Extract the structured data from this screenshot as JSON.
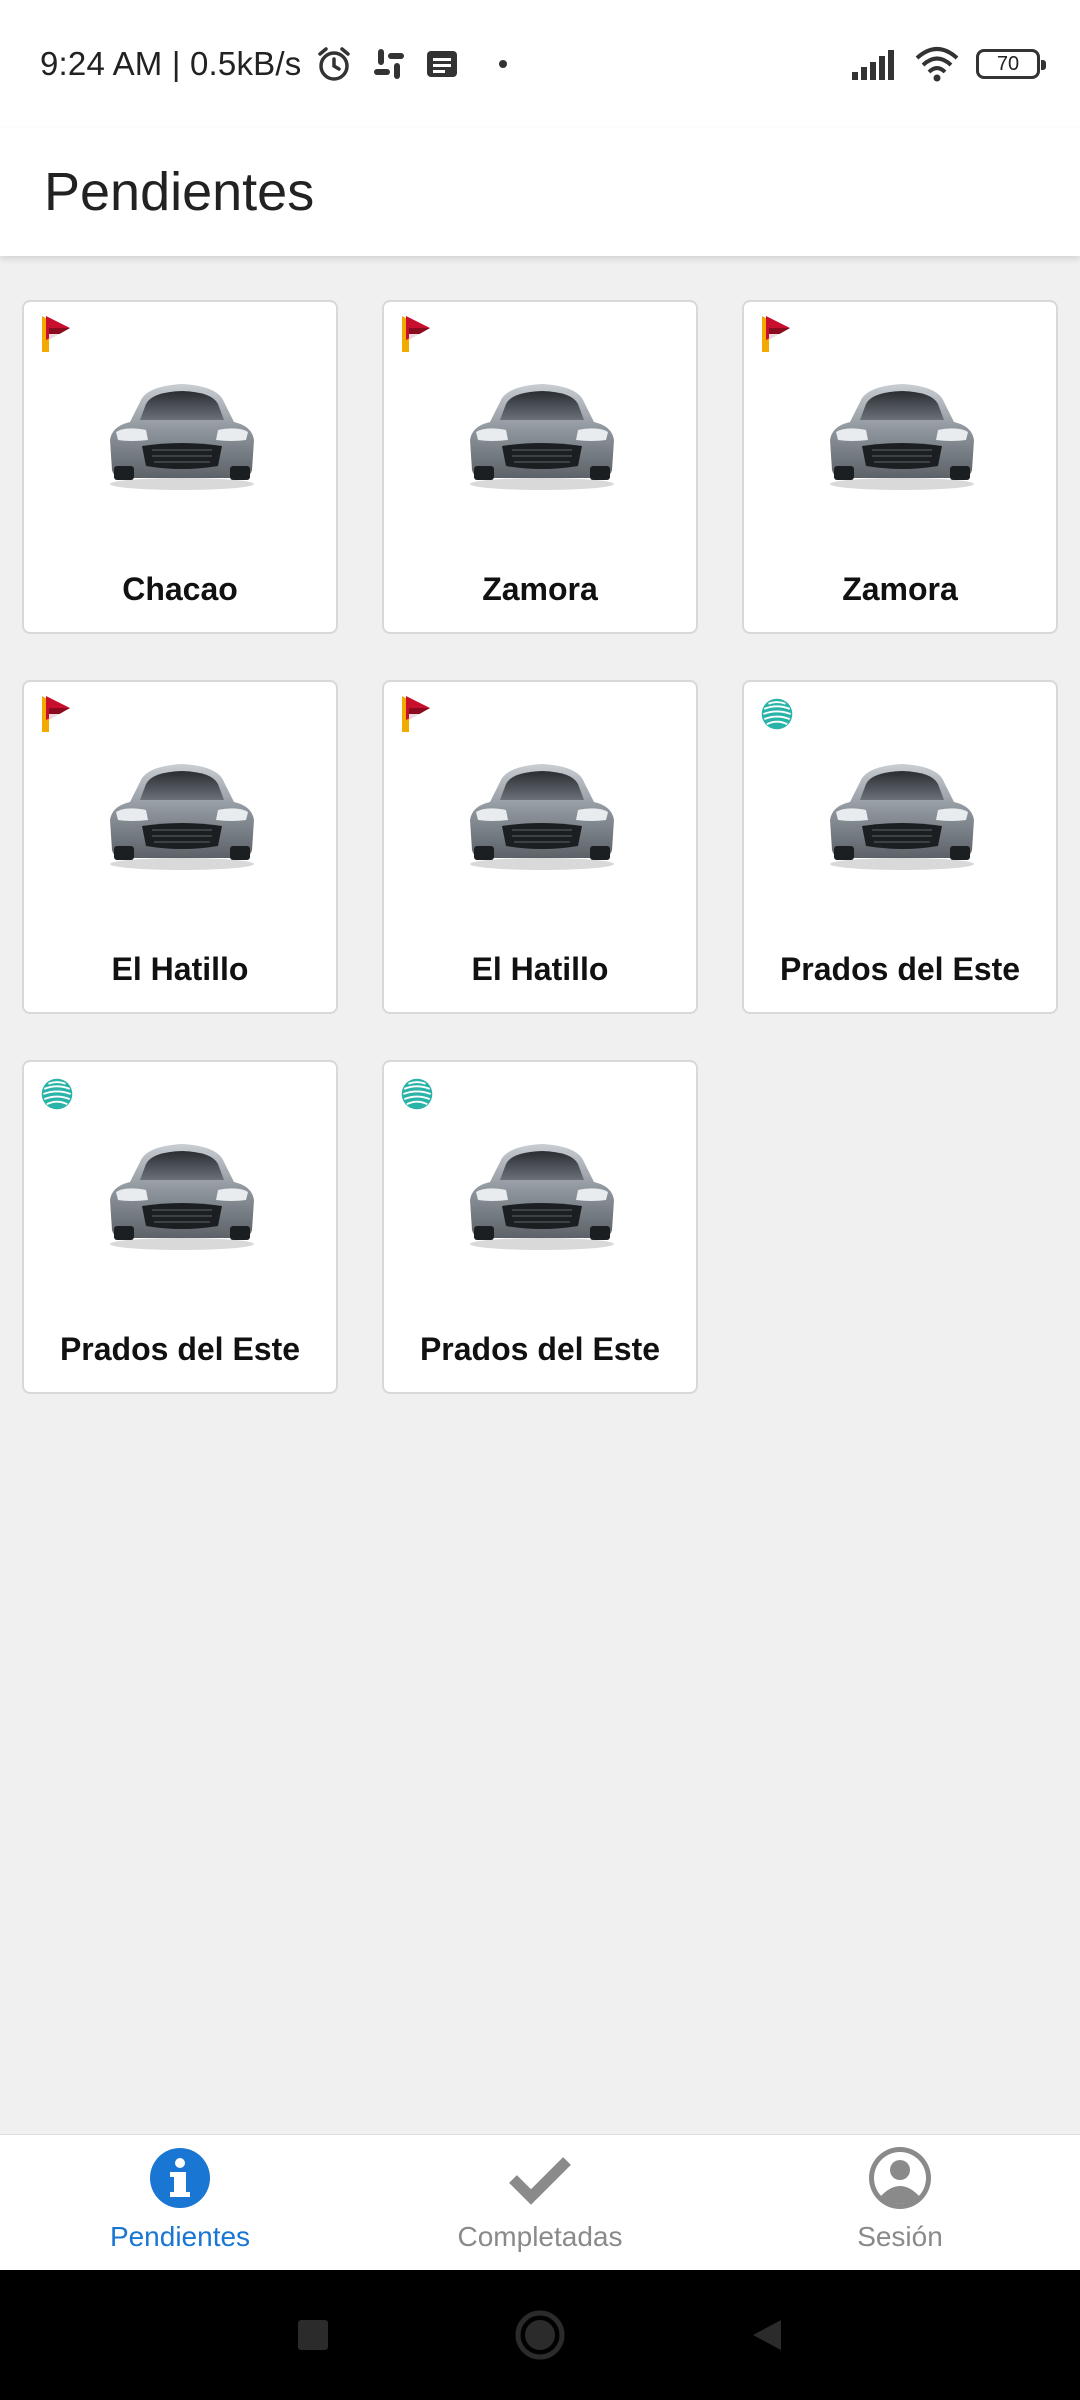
{
  "status_bar": {
    "time": "9:24 AM | 0.5kB/s",
    "battery": "70",
    "icons": [
      "alarm-icon",
      "slack-icon",
      "message-icon",
      "signal-icon",
      "wifi-icon",
      "battery-icon"
    ]
  },
  "header": {
    "title": "Pendientes"
  },
  "cards": [
    {
      "label": "Chacao",
      "logo": "p-logo"
    },
    {
      "label": "Zamora",
      "logo": "p-logo"
    },
    {
      "label": "Zamora",
      "logo": "p-logo"
    },
    {
      "label": "El Hatillo",
      "logo": "p-logo"
    },
    {
      "label": "El Hatillo",
      "logo": "p-logo"
    },
    {
      "label": "Prados del Este",
      "logo": "teal-sphere-logo"
    },
    {
      "label": "Prados del Este",
      "logo": "teal-sphere-logo"
    },
    {
      "label": "Prados del Este",
      "logo": "teal-sphere-logo"
    }
  ],
  "bottom_nav": {
    "items": [
      {
        "label": "Pendientes",
        "icon": "info-icon",
        "active": true
      },
      {
        "label": "Completadas",
        "icon": "check-icon",
        "active": false
      },
      {
        "label": "Sesión",
        "icon": "account-icon",
        "active": false
      }
    ]
  },
  "colors": {
    "accent": "#1976d2",
    "inactive": "#8a8a8a",
    "background": "#f0f0f1",
    "teal": "#2ab3a8"
  }
}
